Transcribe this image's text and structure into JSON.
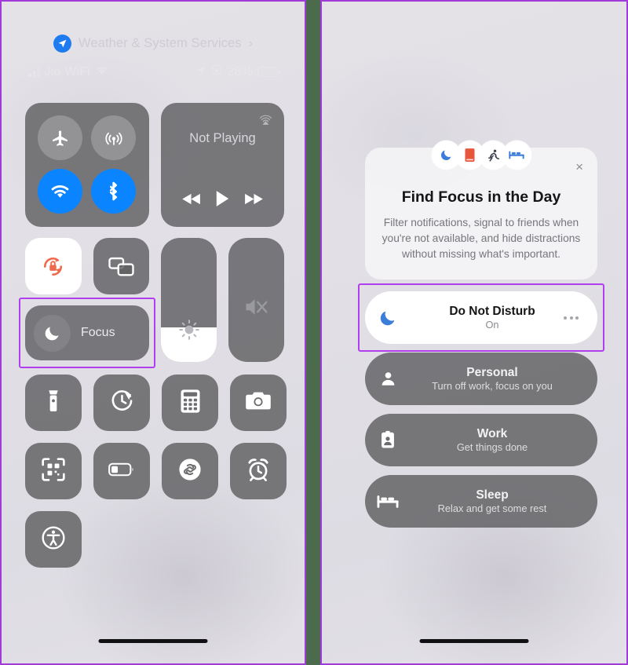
{
  "meta": {
    "accent_purple": "#b13ff0",
    "divider_green": "#4b6b4c",
    "ios_blue": "#0a84ff",
    "tile_gray": "rgba(95,95,98,0.82)"
  },
  "left_panel": {
    "location_banner": {
      "label": "Weather & System Services",
      "chevron": "›",
      "icon": "location-arrow-icon"
    },
    "status_bar": {
      "carrier": "Jio WiFi",
      "battery_percent": "28%",
      "battery_level": 25,
      "signal_bars": 2,
      "icons": [
        "cellular-bars-icon",
        "wifi-icon",
        "location-arrow-icon",
        "rotation-lock-icon",
        "battery-icon"
      ]
    },
    "connectivity": {
      "airplane": {
        "name": "Airplane Mode",
        "state": "off"
      },
      "cellular": {
        "name": "Cellular Data",
        "state": "off"
      },
      "wifi": {
        "name": "Wi-Fi",
        "state": "on"
      },
      "bluetooth": {
        "name": "Bluetooth",
        "state": "on"
      }
    },
    "now_playing": {
      "title": "Not Playing",
      "airplay_icon": "airplay-icon",
      "controls": [
        "rewind-icon",
        "play-icon",
        "fast-forward-icon"
      ]
    },
    "toggles": {
      "orientation_lock": {
        "name": "Orientation Lock",
        "state": "on"
      },
      "screen_mirroring": {
        "name": "Screen Mirroring",
        "state": "off"
      }
    },
    "focus_tile": {
      "label": "Focus",
      "icon": "crescent-moon-icon",
      "highlighted": true
    },
    "sliders": {
      "brightness": {
        "name": "Brightness",
        "value": 28
      },
      "volume": {
        "name": "Volume",
        "value": 0,
        "muted": true
      }
    },
    "shortcuts": [
      {
        "label": "Flashlight",
        "icon": "flashlight-icon"
      },
      {
        "label": "Timer",
        "icon": "timer-icon"
      },
      {
        "label": "Calculator",
        "icon": "calculator-icon"
      },
      {
        "label": "Camera",
        "icon": "camera-icon"
      },
      {
        "label": "Code Scanner",
        "icon": "qr-scanner-icon"
      },
      {
        "label": "Low Power Mode",
        "icon": "low-battery-icon"
      },
      {
        "label": "Music Recognition",
        "icon": "shazam-icon"
      },
      {
        "label": "Alarm",
        "icon": "alarm-clock-icon"
      },
      {
        "label": "Accessibility Shortcuts",
        "icon": "accessibility-icon"
      }
    ]
  },
  "right_panel": {
    "intro_card": {
      "title": "Find Focus in the Day",
      "body": "Filter notifications, signal to friends when you're not available, and hide distractions without missing what's important.",
      "close_label": "×",
      "bubbles": [
        {
          "icon": "crescent-moon-icon",
          "color": "#3b7dd8"
        },
        {
          "icon": "book-icon",
          "color": "#e8553d"
        },
        {
          "icon": "running-person-icon",
          "color": "#3d4250"
        },
        {
          "icon": "bed-icon",
          "color": "#3b7dd8"
        }
      ]
    },
    "focus_modes": [
      {
        "name": "Do Not Disturb",
        "subtitle": "On",
        "icon": "crescent-moon-icon",
        "active": true,
        "highlighted": true,
        "has_more": true
      },
      {
        "name": "Personal",
        "subtitle": "Turn off work, focus on you",
        "icon": "person-icon",
        "active": false,
        "highlighted": false,
        "has_more": false
      },
      {
        "name": "Work",
        "subtitle": "Get things done",
        "icon": "id-badge-icon",
        "active": false,
        "highlighted": false,
        "has_more": false
      },
      {
        "name": "Sleep",
        "subtitle": "Relax and get some rest",
        "icon": "bed-icon",
        "active": false,
        "highlighted": false,
        "has_more": false
      }
    ]
  }
}
